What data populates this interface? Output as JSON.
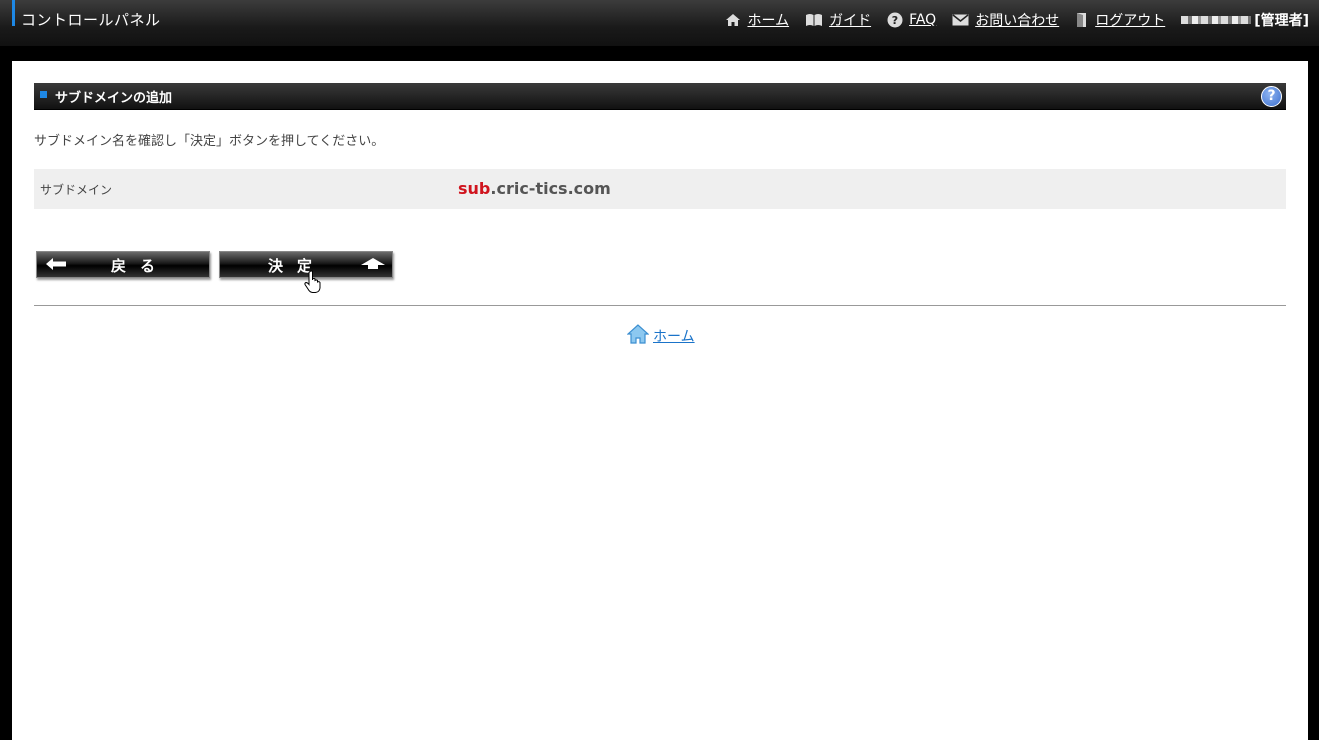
{
  "header": {
    "title": "コントロールパネル",
    "nav": [
      {
        "label": "ホーム",
        "icon": "home-icon"
      },
      {
        "label": "ガイド",
        "icon": "book-icon"
      },
      {
        "label": "FAQ",
        "icon": "question-icon"
      },
      {
        "label": "お問い合わせ",
        "icon": "mail-icon"
      },
      {
        "label": "ログアウト",
        "icon": "door-icon"
      }
    ],
    "user_role": "[管理者]"
  },
  "section": {
    "title": "サブドメインの追加",
    "help": "?"
  },
  "instruction": "サブドメイン名を確認し「決定」ボタンを押してください。",
  "confirm": {
    "label": "サブドメイン",
    "subdomain": "sub",
    "domain": ".cric-tics.com"
  },
  "buttons": {
    "back": "戻る",
    "submit": "決定"
  },
  "footer": {
    "home_link": "ホーム"
  },
  "colors": {
    "accent": "#1e88e5",
    "subdomain_red": "#d0141e",
    "link_blue": "#1a73c9"
  }
}
